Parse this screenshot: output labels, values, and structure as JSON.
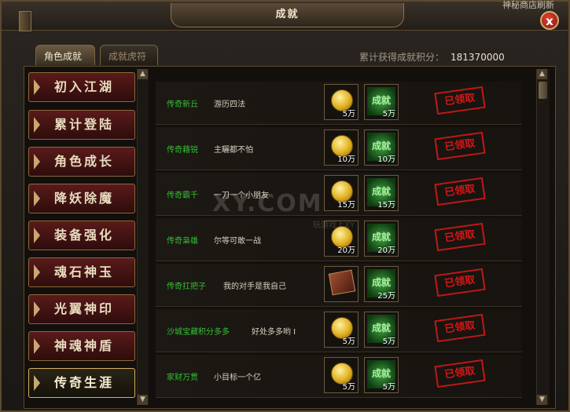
{
  "window": {
    "title": "成就",
    "top_right_text": "神秘商店刷新",
    "close_label": "x"
  },
  "tabs": [
    {
      "label": "角色成就",
      "active": true
    },
    {
      "label": "成就虎符",
      "active": false
    }
  ],
  "score": {
    "label": "累计获得成就积分：",
    "value": "181370000"
  },
  "categories": [
    {
      "label": "初入江湖"
    },
    {
      "label": "累计登陆"
    },
    {
      "label": "角色成长"
    },
    {
      "label": "降妖除魔"
    },
    {
      "label": "装备强化"
    },
    {
      "label": "魂石神玉"
    },
    {
      "label": "光翼神印"
    },
    {
      "label": "神魂神盾"
    },
    {
      "label": "传奇生涯",
      "selected": true
    }
  ],
  "achievements": [
    {
      "name": "传奇新丘",
      "desc": "游历四法",
      "reward1_icon": "gold-coin-icon",
      "reward1_qty": "5万",
      "badge": "成就",
      "reward2_qty": "5万",
      "status": "已领取"
    },
    {
      "name": "传奇藉锐",
      "desc": "主曬都不怕",
      "reward1_icon": "gold-coin-icon",
      "reward1_qty": "10万",
      "badge": "成就",
      "reward2_qty": "10万",
      "status": "已领取"
    },
    {
      "name": "传奇霸千",
      "desc": "一刀一个小朋友",
      "reward1_icon": "gold-coin-icon",
      "reward1_qty": "15万",
      "badge": "成就",
      "reward2_qty": "15万",
      "status": "已领取"
    },
    {
      "name": "传奇枭雄",
      "desc": "尔等可敢一战",
      "reward1_icon": "gold-coin-icon",
      "reward1_qty": "20万",
      "badge": "成就",
      "reward2_qty": "20万",
      "status": "已领取"
    },
    {
      "name": "传奇扛把子",
      "desc": "我的对手是我自己",
      "reward1_icon": "scroll-icon",
      "reward1_qty": "",
      "badge": "成就",
      "reward2_qty": "25万",
      "status": "已领取"
    },
    {
      "name": "沙城宝藏积分多多",
      "desc": "好处多多哟 I",
      "reward1_icon": "gold-coin-icon",
      "reward1_qty": "5万",
      "badge": "成就",
      "reward2_qty": "5万",
      "status": "已领取"
    },
    {
      "name": "家财万贯",
      "desc": "小目标一个亿",
      "reward1_icon": "gold-coin-icon",
      "reward1_qty": "5万",
      "badge": "成就",
      "reward2_qty": "5万",
      "status": "已领取"
    }
  ],
  "watermark": {
    "text": "XY.COM",
    "sub": "玩游戏上XY"
  },
  "colors": {
    "name_green": "#34c034",
    "stamp_red": "#d01818",
    "badge_green": "#40a040"
  }
}
